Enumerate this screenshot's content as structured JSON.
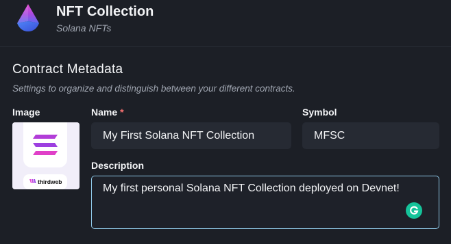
{
  "header": {
    "title": "NFT Collection",
    "subtitle": "Solana NFTs",
    "logo_icon": "thirdweb-nft-logo-icon"
  },
  "section": {
    "title": "Contract Metadata",
    "description": "Settings to organize and distinguish between your different contracts."
  },
  "fields": {
    "image": {
      "label": "Image",
      "thumbnail_icon": "solana-logo-icon",
      "thumbnail_text": "thirdweb"
    },
    "name": {
      "label": "Name",
      "required_marker": "*",
      "value": "My First Solana NFT Collection"
    },
    "symbol": {
      "label": "Symbol",
      "value": "MFSC"
    },
    "description": {
      "label": "Description",
      "value": "My first personal Solana NFT Collection deployed on Devnet!",
      "assistant_icon": "grammarly-icon"
    }
  },
  "colors": {
    "background": "#1c1f26",
    "input_background": "#262a33",
    "focus_border": "#8fc9e8",
    "required": "#f87171",
    "grammarly": "#15c39a"
  }
}
